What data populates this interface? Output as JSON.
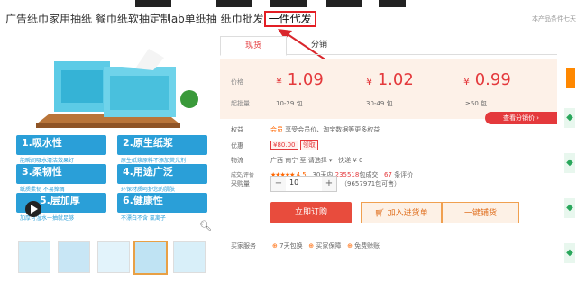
{
  "title": {
    "text": "广告纸巾家用抽纸 餐巾纸软抽定制ab单纸抽 纸巾批发",
    "highlight": "一件代发"
  },
  "note": "本产品条件七天",
  "features": [
    {
      "title": "1.吸水性",
      "sub": "能瞬间吸水清洁效果好"
    },
    {
      "title": "2.原生纸浆",
      "sub": "原生纸浆原料不添加荧光剂"
    },
    {
      "title": "3.柔韧性",
      "sub": "纸质柔韧 不易掉屑"
    },
    {
      "title": "4.用途广泛",
      "sub": "环保材质呵护您的肌肤"
    },
    {
      "title": "5.层加厚",
      "sub": "加厚可湿水一抽就足够"
    },
    {
      "title": "6.健康性",
      "sub": "不漂白不含 氯离子"
    }
  ],
  "tabs": {
    "active": "现货",
    "other": "分销"
  },
  "price": {
    "label_price": "价格",
    "label_moq": "起批量",
    "tiers": [
      {
        "symbol": "¥",
        "value": "1.09",
        "qty": "10-29 包"
      },
      {
        "symbol": "¥",
        "value": "1.02",
        "qty": "30-49 包"
      },
      {
        "symbol": "¥",
        "value": "0.99",
        "qty": "≥50 包"
      }
    ],
    "see_distribution": "查看分销价 ›"
  },
  "rights": {
    "label": "权益",
    "text": "享受会员价、淘宝数据等更多权益",
    "tag": "会员"
  },
  "discount": {
    "label": "优惠",
    "coupon": "¥80.00",
    "get": "领取"
  },
  "logistics": {
    "label": "物流",
    "from": "广西 南宁",
    "to_label": "至",
    "to": "请选择",
    "method": "快递",
    "fee": "¥ 0"
  },
  "reviews": {
    "label": "成交/评价",
    "stars": "★★★★★",
    "score": "4.5",
    "deals_prefix": "30天内",
    "deals": "235518",
    "deals_suffix": "包成交",
    "review_count": "67",
    "review_suffix": "条评价"
  },
  "quantity": {
    "label": "采购量",
    "value": "10",
    "minus": "−",
    "plus": "+",
    "stock": "（9657971包可售）"
  },
  "buttons": {
    "buy": "立即订购",
    "cart": "加入进货单",
    "distribute": "一键铺货"
  },
  "services": {
    "label": "买家服务",
    "items": [
      "7天包换",
      "买家保障",
      "免费赊账"
    ]
  }
}
